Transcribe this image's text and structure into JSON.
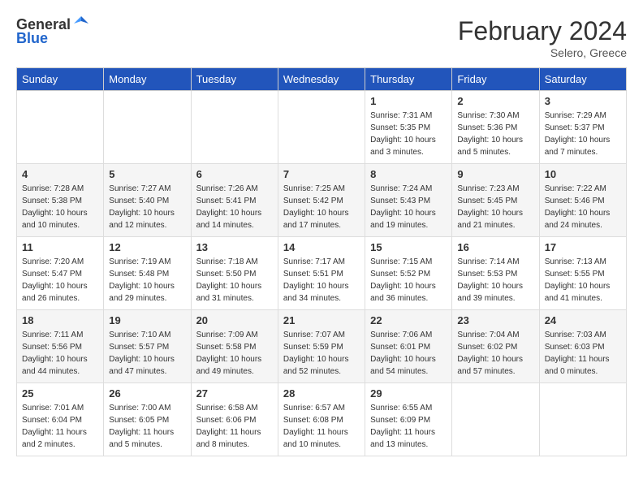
{
  "header": {
    "logo_general": "General",
    "logo_blue": "Blue",
    "month_year": "February 2024",
    "location": "Selero, Greece"
  },
  "days_of_week": [
    "Sunday",
    "Monday",
    "Tuesday",
    "Wednesday",
    "Thursday",
    "Friday",
    "Saturday"
  ],
  "weeks": [
    [
      {
        "day": "",
        "sunrise": "",
        "sunset": "",
        "daylight": ""
      },
      {
        "day": "",
        "sunrise": "",
        "sunset": "",
        "daylight": ""
      },
      {
        "day": "",
        "sunrise": "",
        "sunset": "",
        "daylight": ""
      },
      {
        "day": "",
        "sunrise": "",
        "sunset": "",
        "daylight": ""
      },
      {
        "day": "1",
        "sunrise": "Sunrise: 7:31 AM",
        "sunset": "Sunset: 5:35 PM",
        "daylight": "Daylight: 10 hours and 3 minutes."
      },
      {
        "day": "2",
        "sunrise": "Sunrise: 7:30 AM",
        "sunset": "Sunset: 5:36 PM",
        "daylight": "Daylight: 10 hours and 5 minutes."
      },
      {
        "day": "3",
        "sunrise": "Sunrise: 7:29 AM",
        "sunset": "Sunset: 5:37 PM",
        "daylight": "Daylight: 10 hours and 7 minutes."
      }
    ],
    [
      {
        "day": "4",
        "sunrise": "Sunrise: 7:28 AM",
        "sunset": "Sunset: 5:38 PM",
        "daylight": "Daylight: 10 hours and 10 minutes."
      },
      {
        "day": "5",
        "sunrise": "Sunrise: 7:27 AM",
        "sunset": "Sunset: 5:40 PM",
        "daylight": "Daylight: 10 hours and 12 minutes."
      },
      {
        "day": "6",
        "sunrise": "Sunrise: 7:26 AM",
        "sunset": "Sunset: 5:41 PM",
        "daylight": "Daylight: 10 hours and 14 minutes."
      },
      {
        "day": "7",
        "sunrise": "Sunrise: 7:25 AM",
        "sunset": "Sunset: 5:42 PM",
        "daylight": "Daylight: 10 hours and 17 minutes."
      },
      {
        "day": "8",
        "sunrise": "Sunrise: 7:24 AM",
        "sunset": "Sunset: 5:43 PM",
        "daylight": "Daylight: 10 hours and 19 minutes."
      },
      {
        "day": "9",
        "sunrise": "Sunrise: 7:23 AM",
        "sunset": "Sunset: 5:45 PM",
        "daylight": "Daylight: 10 hours and 21 minutes."
      },
      {
        "day": "10",
        "sunrise": "Sunrise: 7:22 AM",
        "sunset": "Sunset: 5:46 PM",
        "daylight": "Daylight: 10 hours and 24 minutes."
      }
    ],
    [
      {
        "day": "11",
        "sunrise": "Sunrise: 7:20 AM",
        "sunset": "Sunset: 5:47 PM",
        "daylight": "Daylight: 10 hours and 26 minutes."
      },
      {
        "day": "12",
        "sunrise": "Sunrise: 7:19 AM",
        "sunset": "Sunset: 5:48 PM",
        "daylight": "Daylight: 10 hours and 29 minutes."
      },
      {
        "day": "13",
        "sunrise": "Sunrise: 7:18 AM",
        "sunset": "Sunset: 5:50 PM",
        "daylight": "Daylight: 10 hours and 31 minutes."
      },
      {
        "day": "14",
        "sunrise": "Sunrise: 7:17 AM",
        "sunset": "Sunset: 5:51 PM",
        "daylight": "Daylight: 10 hours and 34 minutes."
      },
      {
        "day": "15",
        "sunrise": "Sunrise: 7:15 AM",
        "sunset": "Sunset: 5:52 PM",
        "daylight": "Daylight: 10 hours and 36 minutes."
      },
      {
        "day": "16",
        "sunrise": "Sunrise: 7:14 AM",
        "sunset": "Sunset: 5:53 PM",
        "daylight": "Daylight: 10 hours and 39 minutes."
      },
      {
        "day": "17",
        "sunrise": "Sunrise: 7:13 AM",
        "sunset": "Sunset: 5:55 PM",
        "daylight": "Daylight: 10 hours and 41 minutes."
      }
    ],
    [
      {
        "day": "18",
        "sunrise": "Sunrise: 7:11 AM",
        "sunset": "Sunset: 5:56 PM",
        "daylight": "Daylight: 10 hours and 44 minutes."
      },
      {
        "day": "19",
        "sunrise": "Sunrise: 7:10 AM",
        "sunset": "Sunset: 5:57 PM",
        "daylight": "Daylight: 10 hours and 47 minutes."
      },
      {
        "day": "20",
        "sunrise": "Sunrise: 7:09 AM",
        "sunset": "Sunset: 5:58 PM",
        "daylight": "Daylight: 10 hours and 49 minutes."
      },
      {
        "day": "21",
        "sunrise": "Sunrise: 7:07 AM",
        "sunset": "Sunset: 5:59 PM",
        "daylight": "Daylight: 10 hours and 52 minutes."
      },
      {
        "day": "22",
        "sunrise": "Sunrise: 7:06 AM",
        "sunset": "Sunset: 6:01 PM",
        "daylight": "Daylight: 10 hours and 54 minutes."
      },
      {
        "day": "23",
        "sunrise": "Sunrise: 7:04 AM",
        "sunset": "Sunset: 6:02 PM",
        "daylight": "Daylight: 10 hours and 57 minutes."
      },
      {
        "day": "24",
        "sunrise": "Sunrise: 7:03 AM",
        "sunset": "Sunset: 6:03 PM",
        "daylight": "Daylight: 11 hours and 0 minutes."
      }
    ],
    [
      {
        "day": "25",
        "sunrise": "Sunrise: 7:01 AM",
        "sunset": "Sunset: 6:04 PM",
        "daylight": "Daylight: 11 hours and 2 minutes."
      },
      {
        "day": "26",
        "sunrise": "Sunrise: 7:00 AM",
        "sunset": "Sunset: 6:05 PM",
        "daylight": "Daylight: 11 hours and 5 minutes."
      },
      {
        "day": "27",
        "sunrise": "Sunrise: 6:58 AM",
        "sunset": "Sunset: 6:06 PM",
        "daylight": "Daylight: 11 hours and 8 minutes."
      },
      {
        "day": "28",
        "sunrise": "Sunrise: 6:57 AM",
        "sunset": "Sunset: 6:08 PM",
        "daylight": "Daylight: 11 hours and 10 minutes."
      },
      {
        "day": "29",
        "sunrise": "Sunrise: 6:55 AM",
        "sunset": "Sunset: 6:09 PM",
        "daylight": "Daylight: 11 hours and 13 minutes."
      },
      {
        "day": "",
        "sunrise": "",
        "sunset": "",
        "daylight": ""
      },
      {
        "day": "",
        "sunrise": "",
        "sunset": "",
        "daylight": ""
      }
    ]
  ]
}
